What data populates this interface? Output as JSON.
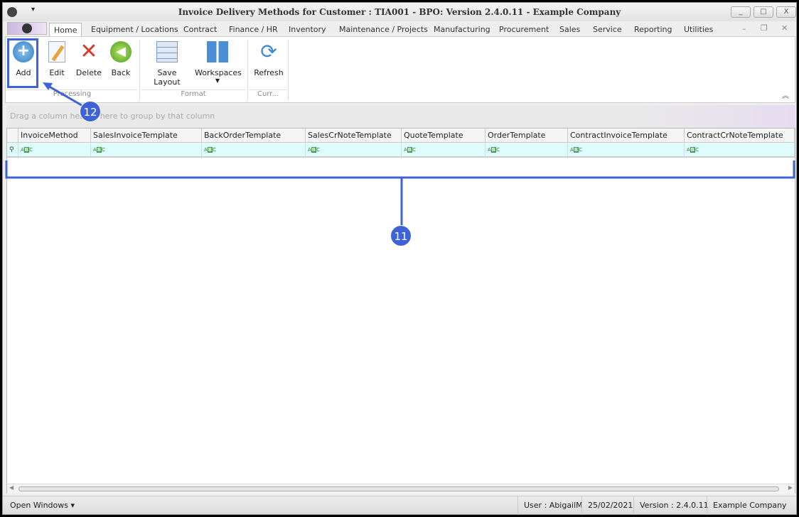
{
  "window": {
    "title_prefix": "Invoice Delivery Methods for Customer : TIA001 - ",
    "title_bold": "BPO:",
    "title_rest": " Version 2.4.0.11 - Example Company",
    "minimize": "_",
    "maximize": "□",
    "close": "X"
  },
  "tabs": [
    "Home",
    "Equipment / Locations",
    "Contract",
    "Finance / HR",
    "Inventory",
    "Maintenance / Projects",
    "Manufacturing",
    "Procurement",
    "Sales",
    "Service",
    "Reporting",
    "Utilities"
  ],
  "ribbon": {
    "buttons": {
      "add": "Add",
      "edit": "Edit",
      "delete": "Delete",
      "back": "Back",
      "save_layout": "Save Layout",
      "workspaces": "Workspaces",
      "refresh": "Refresh"
    },
    "groups": {
      "processing": "Processing",
      "format": "Format",
      "currency": "Curr..."
    }
  },
  "grid": {
    "group_panel": "Drag a column header here to group by that column",
    "columns": [
      "InvoiceMethod",
      "SalesInvoiceTemplate",
      "BackOrderTemplate",
      "SalesCrNoteTemplate",
      "QuoteTemplate",
      "OrderTemplate",
      "ContractInvoiceTemplate",
      "ContractCrNoteTemplate"
    ],
    "filter_icon": "ABC"
  },
  "status": {
    "open_windows": "Open Windows ▾",
    "user": "User : AbigailM",
    "date": "25/02/2021",
    "version": "Version : 2.4.0.11",
    "company": "Example Company"
  },
  "annotations": {
    "a11": "11",
    "a12": "12"
  },
  "colors": {
    "accent": "#3d63d6",
    "filter_row": "#dffcfc"
  }
}
